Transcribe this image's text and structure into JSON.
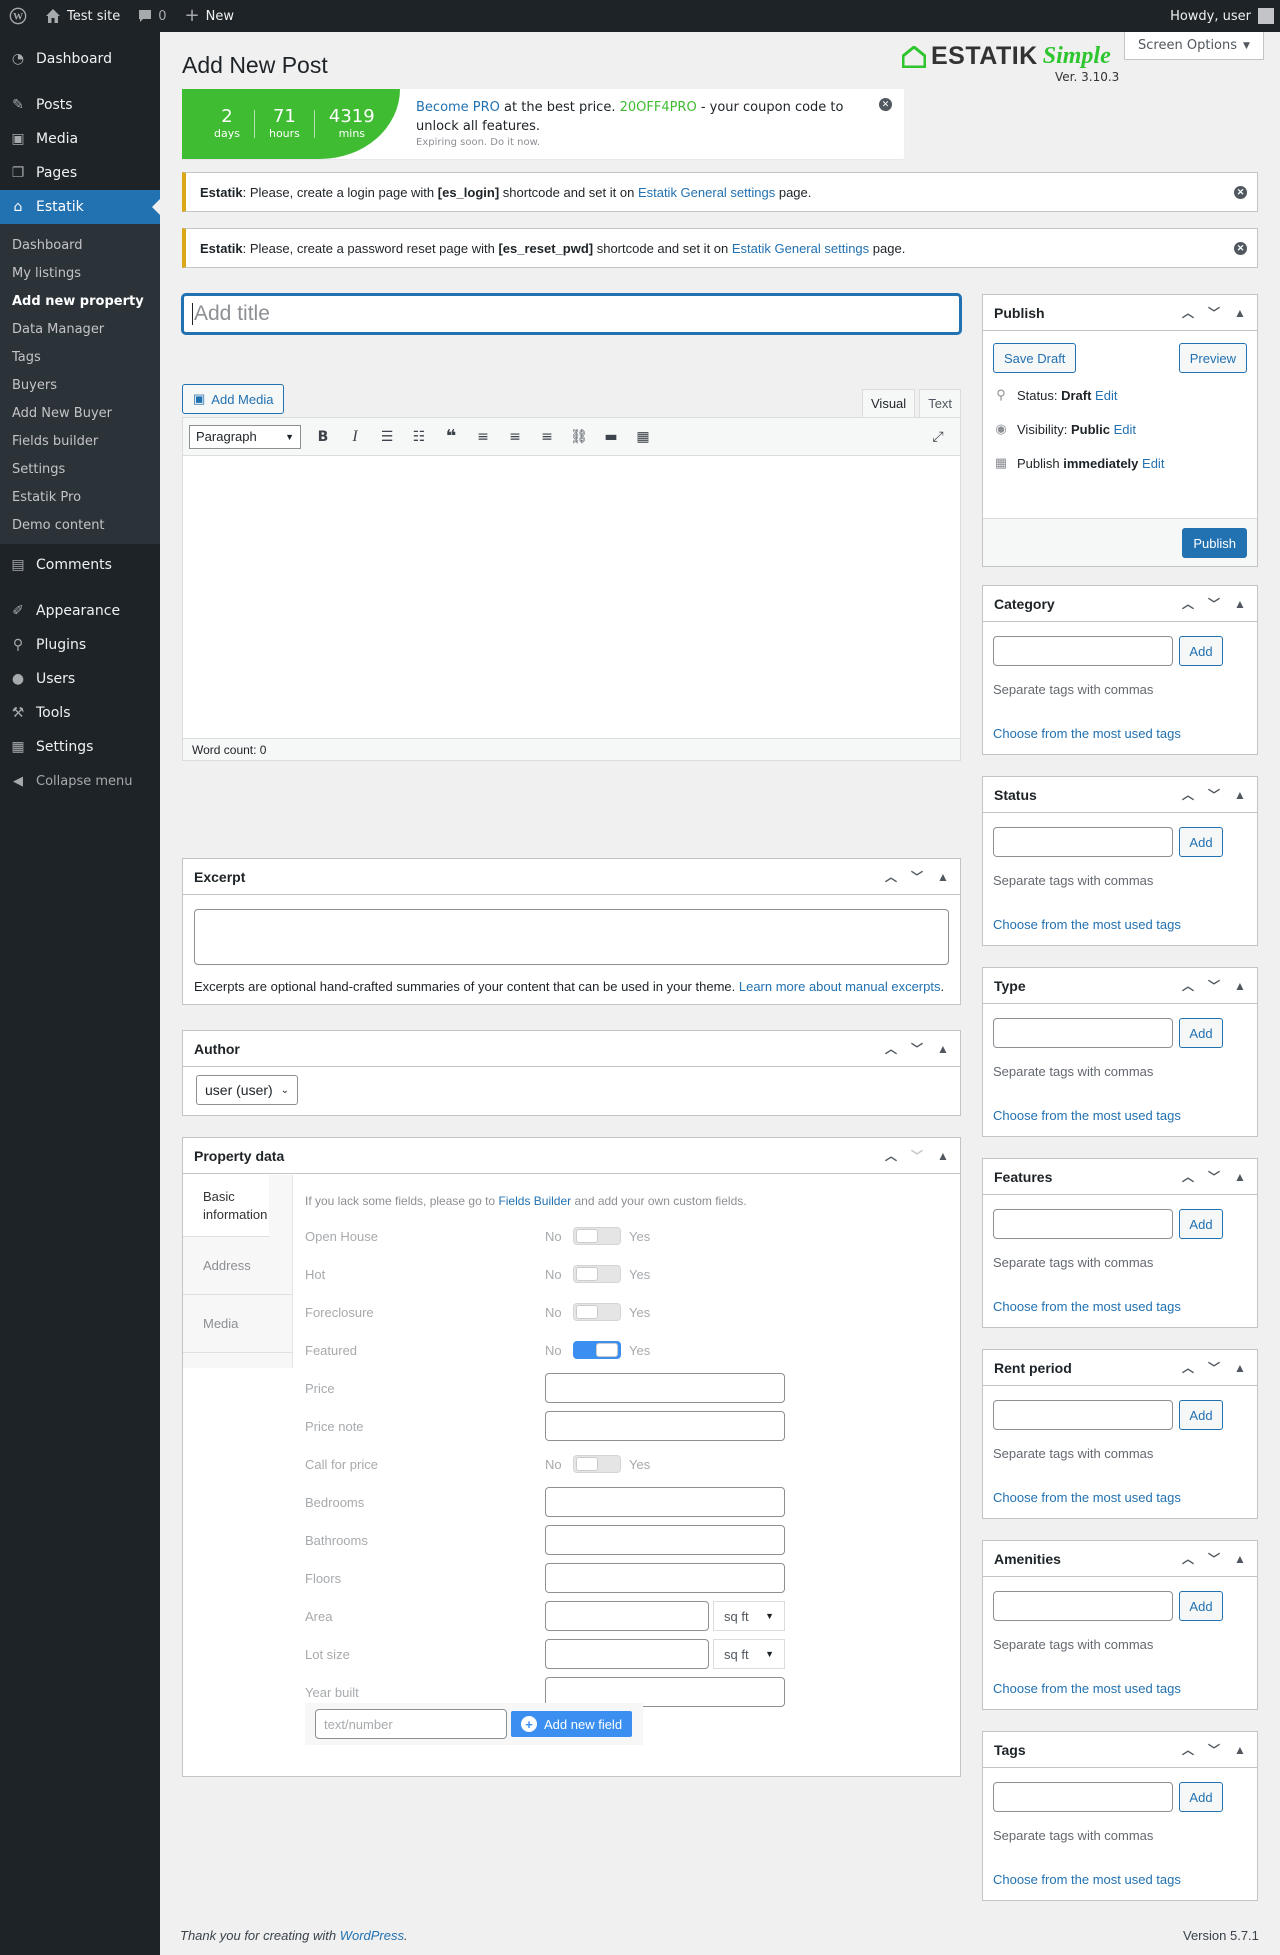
{
  "adminbar": {
    "site_name": "Test site",
    "comments_count": "0",
    "new_label": "New",
    "howdy": "Howdy, user"
  },
  "sidebar": {
    "top_items": [
      {
        "label": "Dashboard",
        "icon": "dashboard-icon"
      },
      {
        "label": "Posts",
        "icon": "pin-icon"
      },
      {
        "label": "Media",
        "icon": "media-icon"
      },
      {
        "label": "Pages",
        "icon": "pages-icon"
      },
      {
        "label": "Estatik",
        "icon": "home-icon"
      }
    ],
    "submenu": [
      "Dashboard",
      "My listings",
      "Add new property",
      "Data Manager",
      "Tags",
      "Buyers",
      "Add New Buyer",
      "Fields builder",
      "Settings",
      "Estatik Pro",
      "Demo content"
    ],
    "bottom_items": [
      {
        "label": "Comments",
        "icon": "comment-icon"
      },
      {
        "label": "Appearance",
        "icon": "brush-icon"
      },
      {
        "label": "Plugins",
        "icon": "plugin-icon"
      },
      {
        "label": "Users",
        "icon": "user-icon"
      },
      {
        "label": "Tools",
        "icon": "wrench-icon"
      },
      {
        "label": "Settings",
        "icon": "settings-icon"
      }
    ],
    "collapse_label": "Collapse menu"
  },
  "header": {
    "title": "Add New Post",
    "screen_options": "Screen Options",
    "brand_name": "ESTATIK",
    "brand_edition": "Simple",
    "brand_version": "Ver. 3.10.3"
  },
  "promo": {
    "days": "2",
    "days_label": "days",
    "hours": "71",
    "hours_label": "hours",
    "mins": "4319",
    "mins_label": "mins",
    "link_text": "Become PRO",
    "text_1": " at the best price. ",
    "code": "20OFF4PRO",
    "text_2": " - your coupon code to unlock all features.",
    "sub": "Expiring soon. Do it now.",
    "accent": "#3fbc32"
  },
  "notices": [
    {
      "brand": "Estatik",
      "pre": ": Please, create a login page with ",
      "code": "[es_login]",
      "mid": " shortcode and set it on ",
      "link": "Estatik General settings",
      "post": " page."
    },
    {
      "brand": "Estatik",
      "pre": ": Please, create a password reset page with ",
      "code": "[es_reset_pwd]",
      "mid": " shortcode and set it on ",
      "link": "Estatik General settings",
      "post": " page."
    }
  ],
  "editor": {
    "title_placeholder": "Add title",
    "add_media": "Add Media",
    "tab_visual": "Visual",
    "tab_text": "Text",
    "format": "Paragraph",
    "word_count": "Word count: 0"
  },
  "excerpt": {
    "title": "Excerpt",
    "help": "Excerpts are optional hand-crafted summaries of your content that can be used in your theme. ",
    "help_link": "Learn more about manual excerpts",
    "help_end": "."
  },
  "author": {
    "title": "Author",
    "value": "user (user)"
  },
  "property": {
    "title": "Property data",
    "tabs": [
      "Basic information",
      "Address",
      "Media"
    ],
    "help_pre": "If you lack some fields, please go to ",
    "help_link": "Fields Builder",
    "help_post": " and add your own custom fields.",
    "no": "No",
    "yes": "Yes",
    "fields": {
      "open_house": "Open House",
      "hot": "Hot",
      "foreclosure": "Foreclosure",
      "featured": "Featured",
      "price": "Price",
      "price_note": "Price note",
      "call_for_price": "Call for price",
      "bedrooms": "Bedrooms",
      "bathrooms": "Bathrooms",
      "floors": "Floors",
      "area": "Area",
      "lot_size": "Lot size",
      "year_built": "Year built"
    },
    "toggles": {
      "open_house": false,
      "hot": false,
      "foreclosure": false,
      "featured": true,
      "call_for_price": false
    },
    "unit": "sq ft",
    "new_field_placeholder": "text/number",
    "new_field_button": "Add new field"
  },
  "publish": {
    "title": "Publish",
    "save_draft": "Save Draft",
    "preview": "Preview",
    "status_label": "Status: ",
    "status_value": "Draft",
    "visibility_label": "Visibility: ",
    "visibility_value": "Public",
    "publish_label": "Publish ",
    "publish_value": "immediately",
    "edit": "Edit",
    "publish_button": "Publish"
  },
  "taxonomies": {
    "add": "Add",
    "help": "Separate tags with commas",
    "link": "Choose from the most used tags",
    "items": [
      "Category",
      "Status",
      "Type",
      "Features",
      "Rent period",
      "Amenities",
      "Tags"
    ]
  },
  "footer": {
    "pre": "Thank you for creating with ",
    "link": "WordPress",
    "post": ".",
    "version": "Version 5.7.1"
  }
}
